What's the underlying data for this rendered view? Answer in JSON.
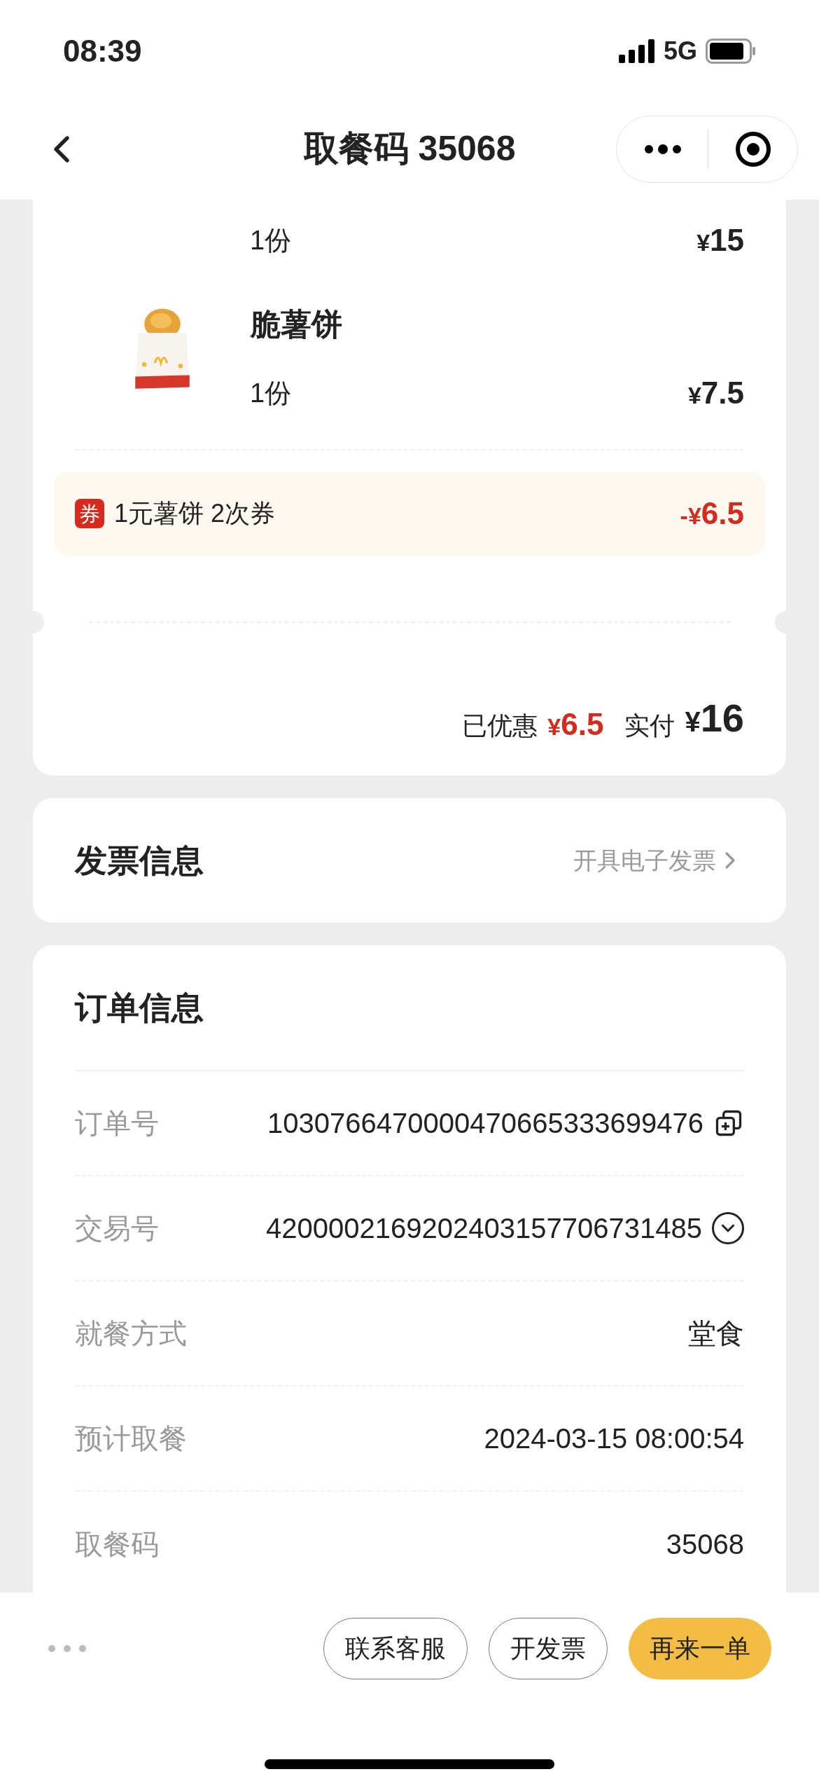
{
  "status_bar": {
    "time": "08:39",
    "network": "5G"
  },
  "nav": {
    "title": "取餐码 35068"
  },
  "order_items": [
    {
      "quantity": "1份",
      "currency": "¥",
      "amount": "15"
    },
    {
      "name": "脆薯饼",
      "quantity": "1份",
      "currency": "¥",
      "amount": "7.5",
      "kind": "picture"
    }
  ],
  "coupon": {
    "badge": "券",
    "name": "1元薯饼 2次券",
    "currency": "-¥",
    "amount": "6.5"
  },
  "summary": {
    "discount_label": "已优惠",
    "discount_currency": "¥",
    "discount_amount": "6.5",
    "paid_label": "实付",
    "paid_currency": "¥",
    "paid_amount": "16"
  },
  "invoice": {
    "title": "发票信息",
    "action": "开具电子发票"
  },
  "order_info": {
    "title": "订单信息",
    "rows": [
      {
        "label": "订单号",
        "value": "1030766470000470665333699476",
        "kind": "copy"
      },
      {
        "label": "交易号",
        "value": "4200002169202403157706731485",
        "kind": "expand"
      },
      {
        "label": "就餐方式",
        "value": "堂食",
        "kind": "plain"
      },
      {
        "label": "预计取餐",
        "value": "2024-03-15 08:00:54",
        "kind": "plain"
      },
      {
        "label": "取餐码",
        "value": "35068",
        "kind": "plain"
      }
    ]
  },
  "actions": [
    {
      "label": "联系客服",
      "kind": "outline"
    },
    {
      "label": "开发票",
      "kind": "outline"
    },
    {
      "label": "再来一单",
      "kind": "primary"
    }
  ]
}
